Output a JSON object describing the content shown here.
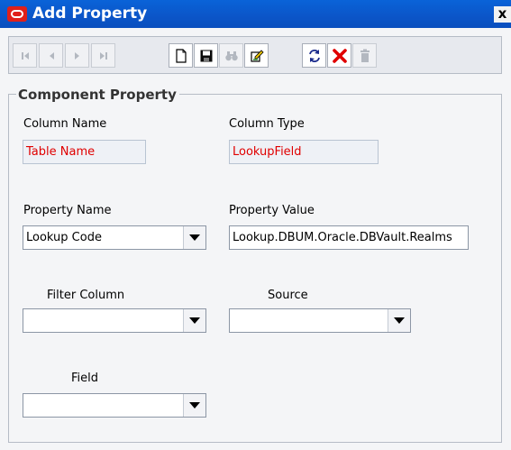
{
  "window": {
    "title": "Add Property",
    "close_label": "x"
  },
  "toolbar": {
    "buttons": [
      {
        "name": "first-record",
        "icon": "first-icon",
        "enabled": false
      },
      {
        "name": "previous-record",
        "icon": "previous-icon",
        "enabled": false
      },
      {
        "name": "next-record",
        "icon": "next-icon",
        "enabled": false
      },
      {
        "name": "last-record",
        "icon": "last-icon",
        "enabled": false
      },
      {
        "name": "new",
        "icon": "new-document-icon",
        "enabled": true
      },
      {
        "name": "save",
        "icon": "save-icon",
        "enabled": true
      },
      {
        "name": "find",
        "icon": "binoculars-icon",
        "enabled": false
      },
      {
        "name": "edit",
        "icon": "edit-icon",
        "enabled": true
      },
      {
        "name": "refresh",
        "icon": "refresh-icon",
        "enabled": true
      },
      {
        "name": "cancel",
        "icon": "cancel-icon",
        "enabled": true
      },
      {
        "name": "delete",
        "icon": "trash-icon",
        "enabled": false
      }
    ]
  },
  "form": {
    "group_title": "Component Property",
    "column_name": {
      "label": "Column Name",
      "value": "Table Name"
    },
    "column_type": {
      "label": "Column Type",
      "value": "LookupField"
    },
    "property_name": {
      "label": "Property Name",
      "value": "Lookup Code"
    },
    "property_value": {
      "label": "Property Value",
      "value": "Lookup.DBUM.Oracle.DBVault.Realms"
    },
    "filter_column": {
      "label": "Filter Column",
      "value": ""
    },
    "source": {
      "label": "Source",
      "value": ""
    },
    "field": {
      "label": "Field",
      "value": ""
    }
  },
  "colors": {
    "title_bar": "#0b55c8",
    "readonly_text": "#e00000",
    "cancel_icon": "#e00000"
  }
}
